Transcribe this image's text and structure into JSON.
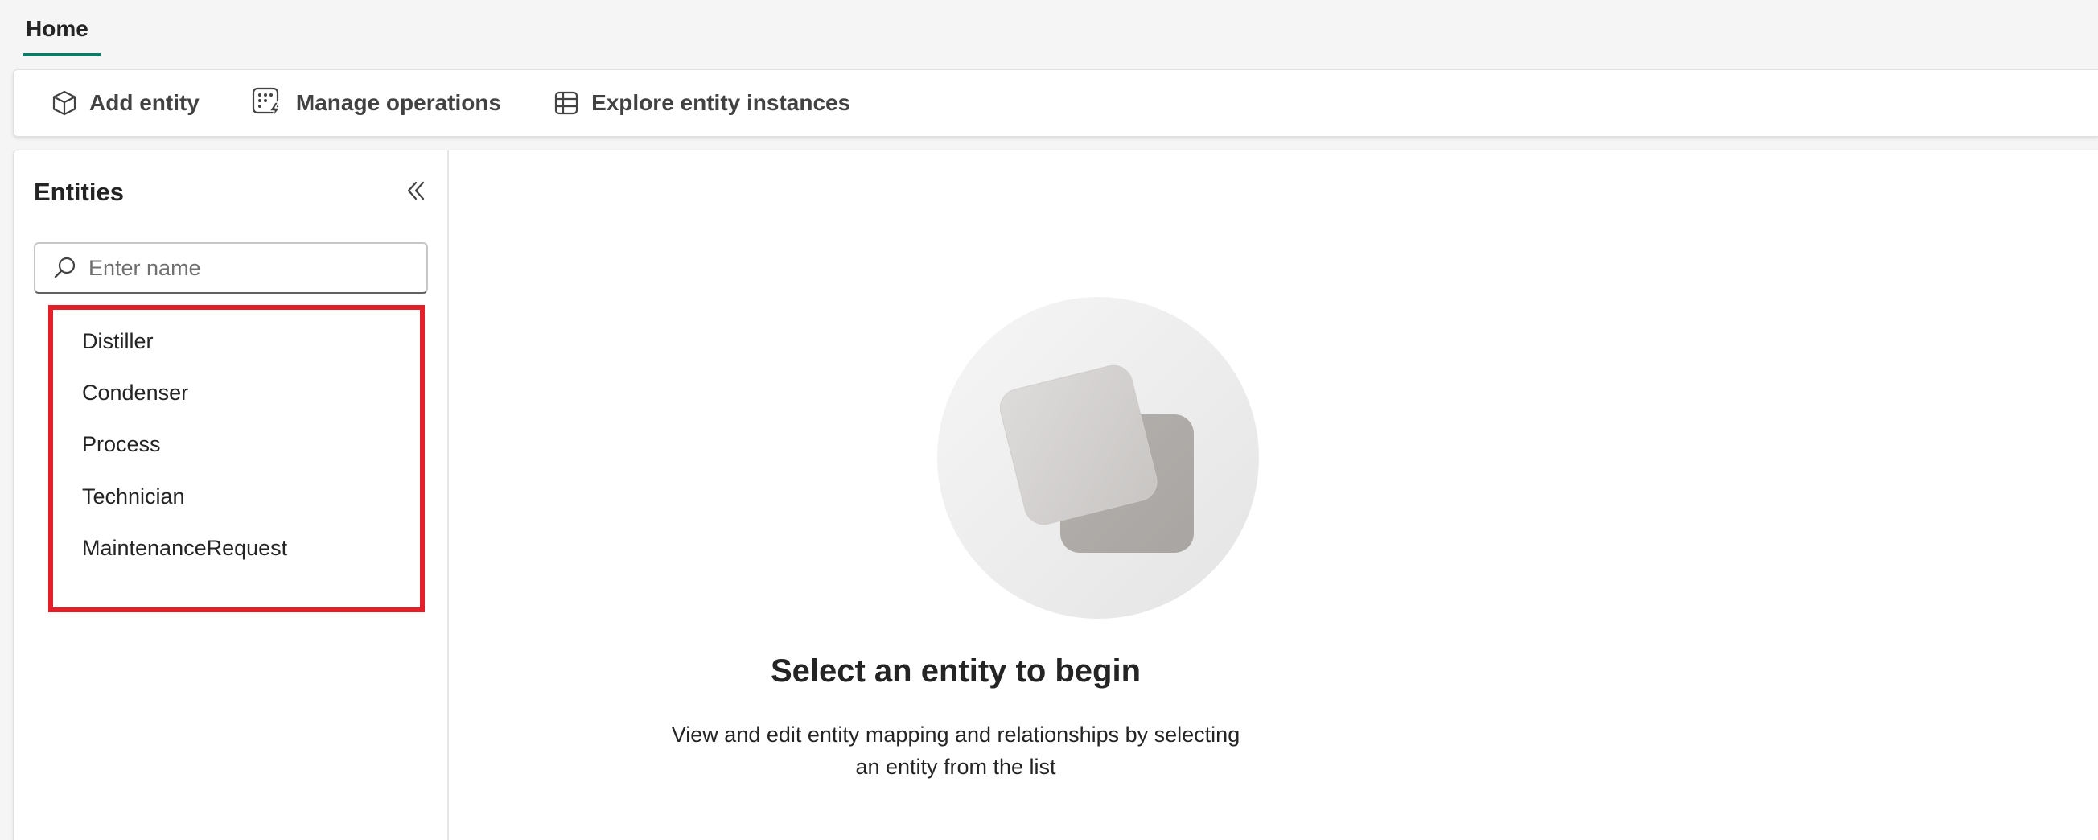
{
  "tabs": {
    "home_label": "Home"
  },
  "toolbar": {
    "add_entity_label": "Add entity",
    "manage_operations_label": "Manage operations",
    "explore_instances_label": "Explore entity instances"
  },
  "sidebar": {
    "title": "Entities",
    "search_placeholder": "Enter name",
    "items": [
      {
        "label": "Distiller"
      },
      {
        "label": "Condenser"
      },
      {
        "label": "Process"
      },
      {
        "label": "Technician"
      },
      {
        "label": "MaintenanceRequest"
      }
    ]
  },
  "empty_state": {
    "title": "Select an entity to begin",
    "description_line1": "View and edit entity mapping and relationships by selecting",
    "description_line2": "an entity from the list"
  },
  "colors": {
    "accent": "#117865",
    "highlight_border": "#e3202a",
    "background": "#f5f5f5"
  },
  "icons": {
    "add_entity": "cube-icon",
    "manage_operations": "grid-lightning-icon",
    "explore_instances": "table-icon",
    "collapse": "double-chevron-left-icon",
    "search": "search-icon"
  }
}
